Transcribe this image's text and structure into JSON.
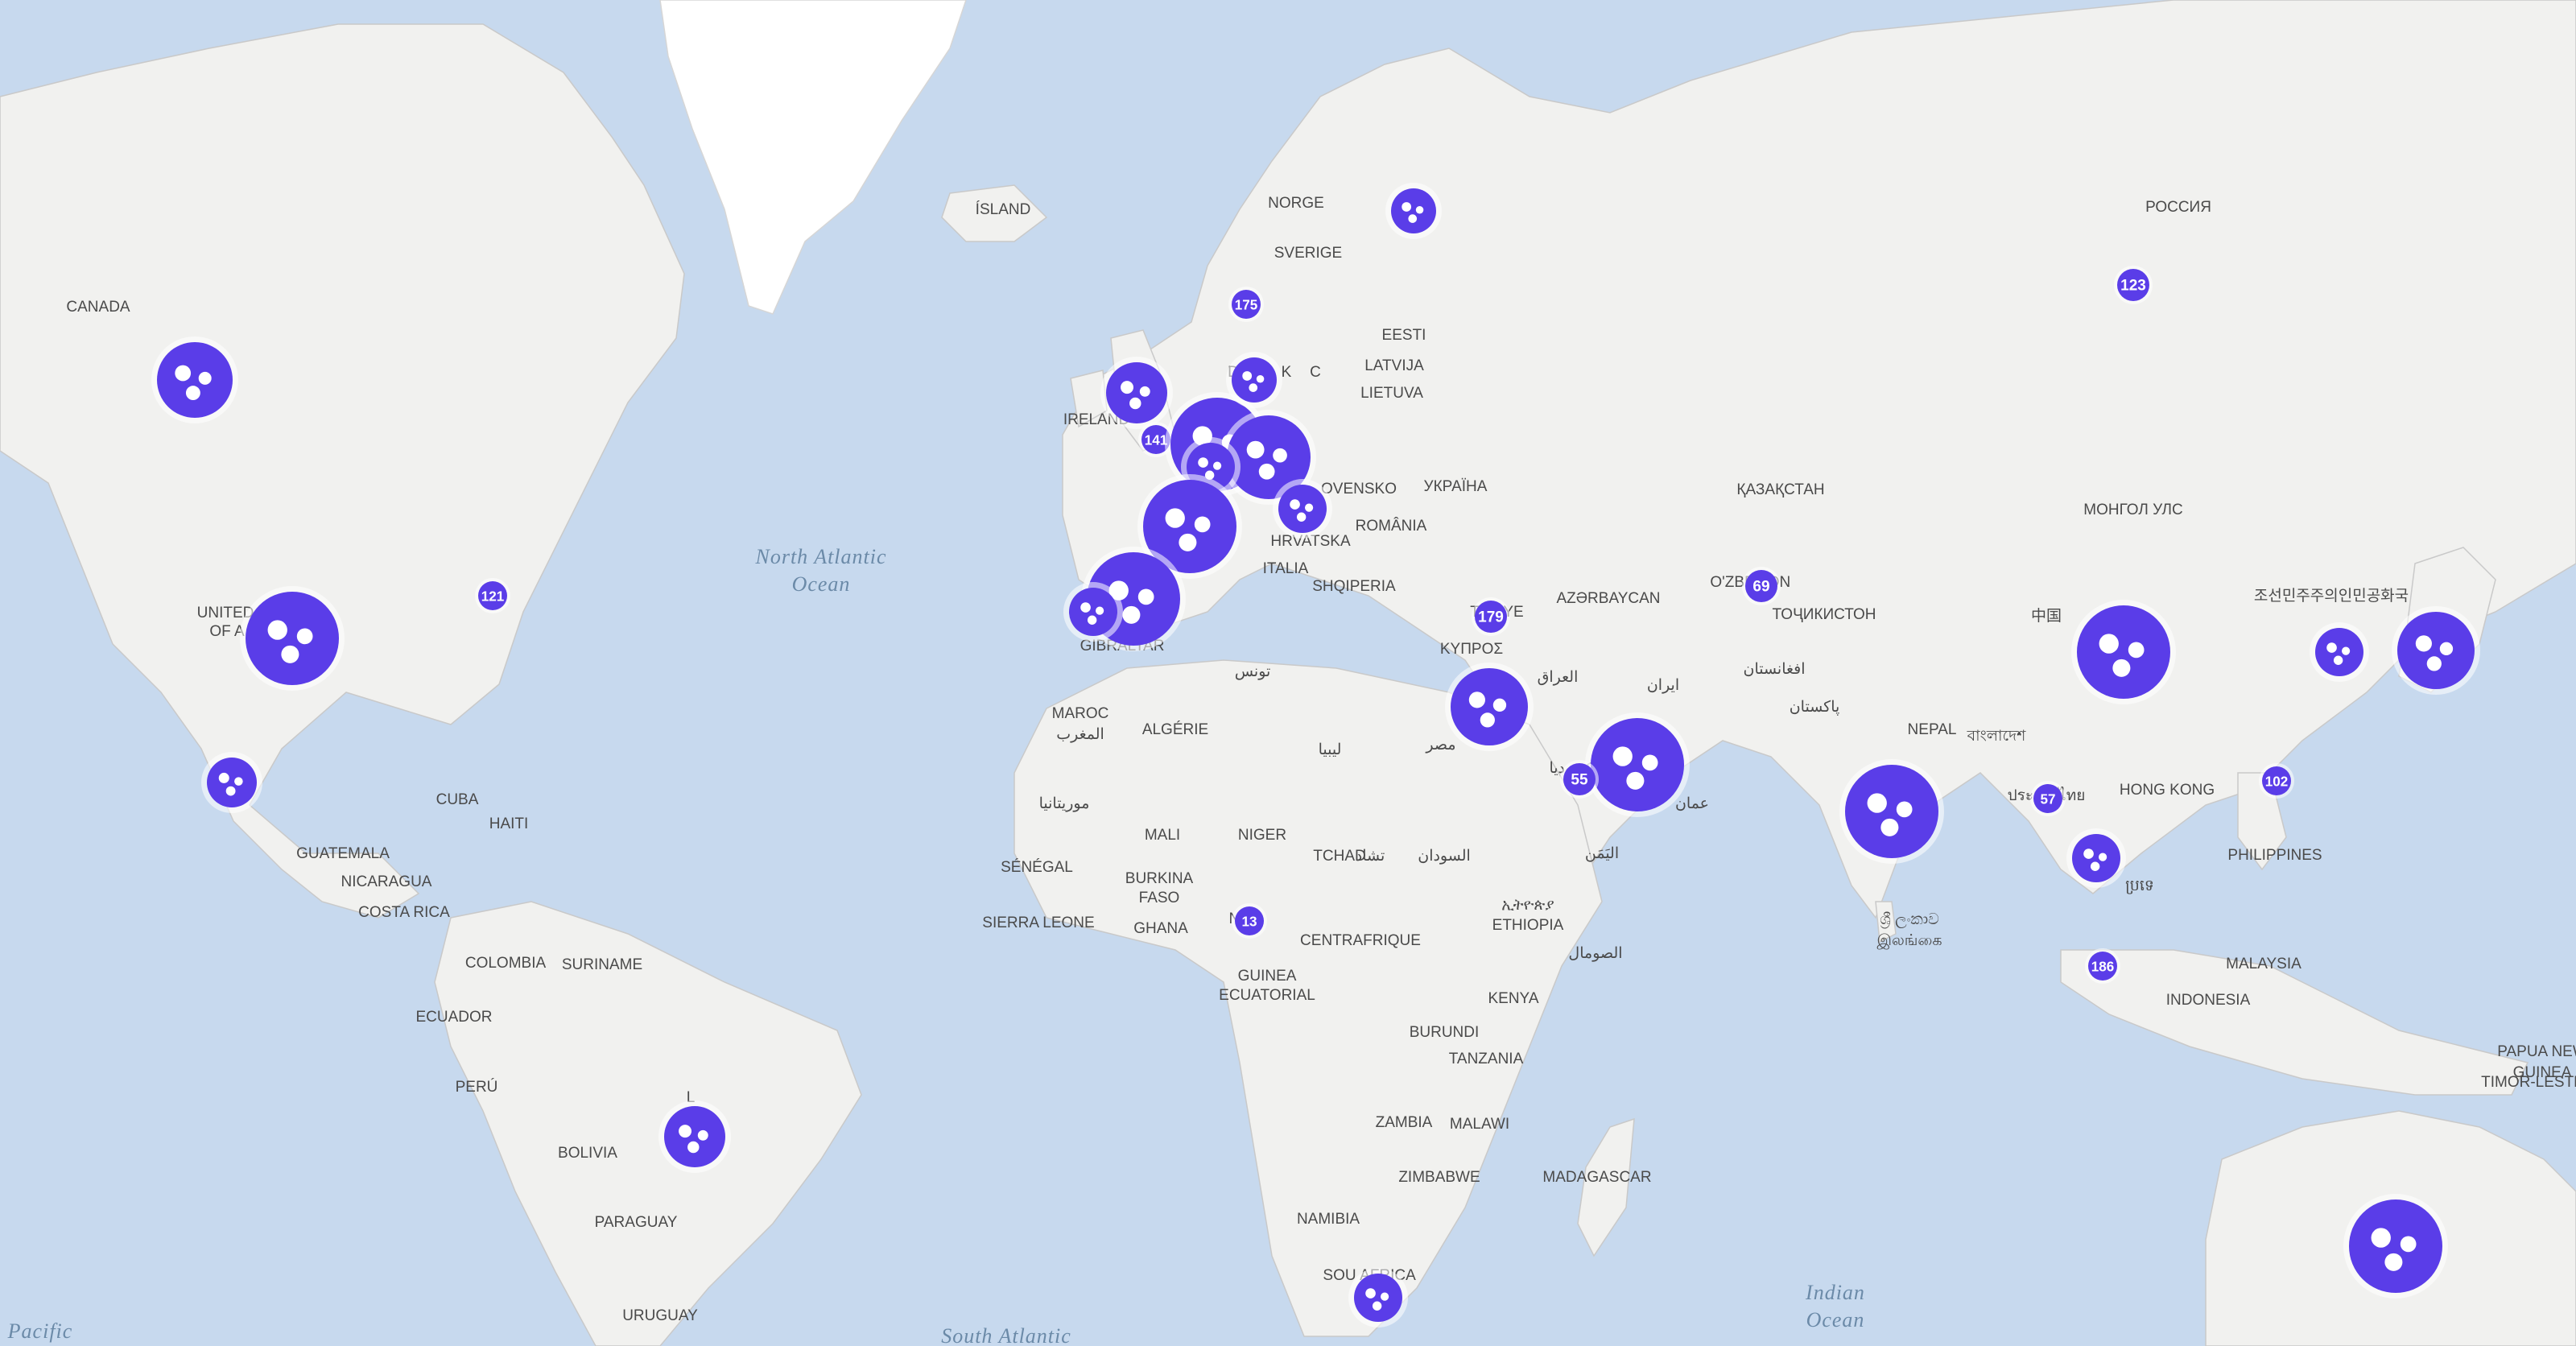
{
  "map": {
    "oceans": [
      {
        "id": "north-atlantic",
        "lines": [
          "North Atlantic",
          "Ocean"
        ]
      },
      {
        "id": "south-atlantic",
        "lines": [
          "South Atlantic"
        ]
      },
      {
        "id": "indian",
        "lines": [
          "Indian",
          "Ocean"
        ]
      },
      {
        "id": "pacific",
        "lines": [
          "Pacific"
        ]
      }
    ],
    "labels": [
      "CANADA",
      "UNITED",
      "OF A",
      "ÍSLAND",
      "NORGE",
      "SVERIGE",
      "EESTI",
      "LATVIJA",
      "LIETUVA",
      "D",
      "K",
      "IRELAND",
      "OVENSKO",
      "УКРАЇНА",
      "HRVATSKA",
      "ROMÂNIA",
      "ITALIA",
      "SHQIPERIA",
      "AZƏRBAYCAN",
      "ҚАЗАҚСТАН",
      "O'ZBE",
      "ON",
      "ТОҶИКИСТОН",
      "РОССИЯ",
      "МОНГОЛ УЛС",
      "中国",
      "조선민주주의인민공화국",
      "T",
      "YE",
      "KYΠΡΟΣ",
      "العراق",
      "ایران",
      "افغانستان",
      "پاکستان",
      "NEPAL",
      "বাংলাদেশ",
      "HONG KONG",
      "PHILIPPINES",
      "MALAYSIA",
      "INDONESIA",
      "PAPUA NEW",
      "GUINEA",
      "TIMOR-LESTE",
      "MAROC",
      "المغرب",
      "ALGÉRIE",
      "تونس",
      "ليبيا",
      "مصر",
      "موريتانيا",
      "MALI",
      "NIGER",
      "TCHAD",
      "تشاد",
      "السودان",
      "SÉNÉGAL",
      "BURKINA",
      "FASO",
      "GHANA",
      "SIERRA LEONE",
      "NI",
      "CENTRAFRIQUE",
      "GUINEA",
      "ECUATORIAL",
      "ኢትዮጵያ",
      "ETHIOPIA",
      "الصومال",
      "KENYA",
      "BURUNDI",
      "TANZANIA",
      "ZAMBIA",
      "MALAWI",
      "ZIMBABWE",
      "NAMIBIA",
      "MADAGASCAR",
      "SOU",
      "AFRICA",
      "عمان",
      "اليَمَن",
      "GIBRALTAR",
      "CUBA",
      "HAITI",
      "GUATEMALA",
      "NICARAGUA",
      "COSTA RICA",
      "COLOMBIA",
      "SURINAME",
      "ECUADOR",
      "PERÚ",
      "BOLIVIA",
      "PARAGUAY",
      "URUGUAY",
      "L",
      "ශ්‍රී ලංකාව",
      "இலங்கை",
      "D",
      "ND",
      "C",
      "ประเทศไทย",
      "ប្រទេ",
      "كمبوديا"
    ],
    "counts": [
      "175",
      "141",
      "121",
      "123",
      "69",
      "179",
      "55",
      "57",
      "102",
      "186",
      "13"
    ],
    "colors": {
      "cluster": "#5a3de8",
      "water": "#c7d9ee",
      "land": "#f1f1ef"
    }
  }
}
